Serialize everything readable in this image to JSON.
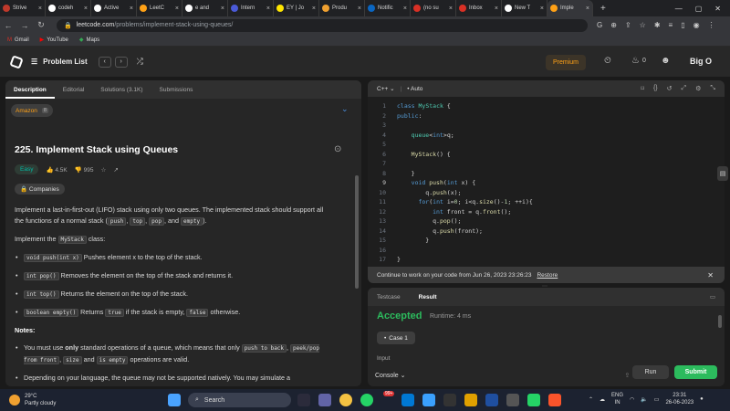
{
  "browser": {
    "tabs": [
      {
        "label": "Strive",
        "color": "#c0392b"
      },
      {
        "label": "codeh",
        "color": "#ffffff"
      },
      {
        "label": "Active",
        "color": "#ffffff"
      },
      {
        "label": "LeetC",
        "color": "#ffa116"
      },
      {
        "label": "e and",
        "color": "#ffffff"
      },
      {
        "label": "Intern",
        "color": "#4a5ad8"
      },
      {
        "label": "EY | Jo",
        "color": "#ffe600"
      },
      {
        "label": "Produ",
        "color": "#f0a030"
      },
      {
        "label": "Notific",
        "color": "#0a66c2"
      },
      {
        "label": "(no su",
        "color": "#d93025"
      },
      {
        "label": "Inbox",
        "color": "#d93025"
      },
      {
        "label": "New T",
        "color": "#ffffff"
      },
      {
        "label": "Imple",
        "color": "#ffa116",
        "active": true
      }
    ],
    "url_host": "leetcode.com",
    "url_path": "/problems/implement-stack-using-queues/",
    "bookmarks": [
      "Gmail",
      "YouTube",
      "Maps"
    ]
  },
  "lc_nav": {
    "problem_list": "Problem List",
    "premium": "Premium",
    "streak": "0",
    "username": "Big O"
  },
  "left": {
    "tabs": [
      "Description",
      "Editorial",
      "Solutions (3.1K)",
      "Submissions"
    ],
    "company_tag": "Amazon",
    "company_count": "8",
    "title": "225. Implement Stack using Queues",
    "difficulty": "Easy",
    "likes": "4.5K",
    "dislikes": "995",
    "companies": "Companies",
    "desc": {
      "p1_a": "Implement a last-in-first-out (LIFO) stack using only two queues. The implemented stack should support all the functions of a normal stack (",
      "push": "push",
      "sep1": ", ",
      "top": "top",
      "sep2": ", ",
      "pop": "pop",
      "sep3": ", and ",
      "empty": "empty",
      "p1_b": ").",
      "p2_a": "Implement the ",
      "mystack": "MyStack",
      "p2_b": " class:",
      "li1_code": "void push(int x)",
      "li1_text": " Pushes element x to the top of the stack.",
      "li2_code": "int pop()",
      "li2_text": " Removes the element on the top of the stack and returns it.",
      "li3_code": "int top()",
      "li3_text": " Returns the element on the top of the stack.",
      "li4_code": "boolean empty()",
      "li4_text": " Returns ",
      "li4_true": "true",
      "li4_mid": " if the stack is empty, ",
      "li4_false": "false",
      "li4_end": " otherwise.",
      "notes": "Notes:",
      "n1_a": "You must use ",
      "n1_only": "only",
      "n1_b": " standard operations of a queue, which means that only ",
      "n1_c1": "push to back",
      "n1_c": ",",
      "n1_c2": "peek/pop from front",
      "n1_d": ", ",
      "n1_c3": "size",
      "n1_e": " and ",
      "n1_c4": "is empty",
      "n1_f": " operations are valid.",
      "n2": "Depending on your language, the queue may not be supported natively. You may simulate a"
    }
  },
  "editor": {
    "language": "C++",
    "mode": "Auto",
    "lines": [
      "1",
      "2",
      "3",
      "4",
      "5",
      "6",
      "7",
      "8",
      "9",
      "10",
      "11",
      "12",
      "13",
      "14",
      "15",
      "16",
      "17",
      "18"
    ],
    "restore_msg": "Continue to work on your code from Jun 26, 2023 23:26:23",
    "restore_link": "Restore"
  },
  "result": {
    "tabs": [
      "Testcase",
      "Result"
    ],
    "status": "Accepted",
    "runtime": "Runtime: 4 ms",
    "case": "Case 1",
    "input_label": "Input",
    "console": "Console",
    "run": "Run",
    "submit": "Submit"
  },
  "taskbar": {
    "temp": "29°C",
    "weather": "Partly cloudy",
    "search": "Search",
    "lang1": "ENG",
    "lang2": "IN",
    "time": "23:31",
    "date": "26-06-2023",
    "badge": "99+"
  }
}
